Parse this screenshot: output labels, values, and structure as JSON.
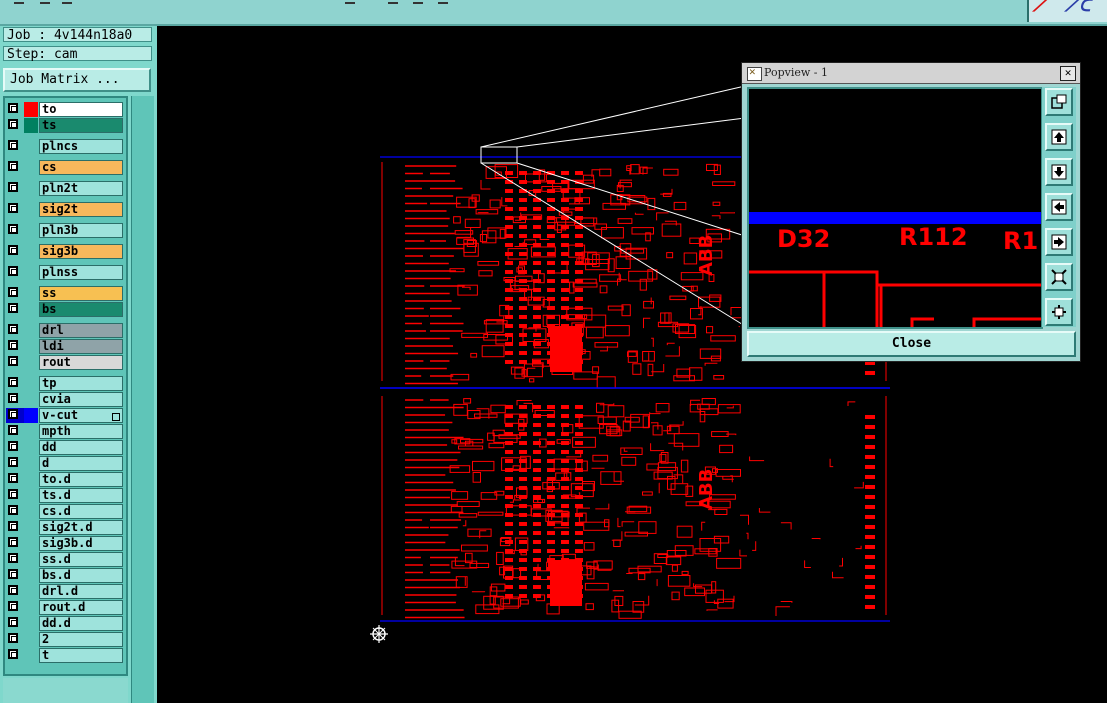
{
  "job_info": {
    "job_line": "Job : 4v144n18a0",
    "step_line": "Step: cam"
  },
  "job_matrix_button": "Job Matrix ...",
  "layers": [
    {
      "name": "to",
      "swatch": "#ff0000",
      "name_bg": "#ffffff"
    },
    {
      "name": "ts",
      "swatch": "#008060",
      "name_bg": "#1a8a6e"
    },
    {
      "name": "plncs",
      "swatch": "",
      "name_bg": "#9ee3dc"
    },
    {
      "name": "cs",
      "swatch": "",
      "name_bg": "#f7b85c"
    },
    {
      "name": "pln2t",
      "swatch": "",
      "name_bg": "#9ee3dc"
    },
    {
      "name": "sig2t",
      "swatch": "",
      "name_bg": "#f7b85c"
    },
    {
      "name": "pln3b",
      "swatch": "",
      "name_bg": "#9ee3dc"
    },
    {
      "name": "sig3b",
      "swatch": "",
      "name_bg": "#f7b85c"
    },
    {
      "name": "plnss",
      "swatch": "",
      "name_bg": "#9ee3dc"
    },
    {
      "name": "ss",
      "swatch": "",
      "name_bg": "#f7c052"
    },
    {
      "name": "bs",
      "swatch": "",
      "name_bg": "#1a8a6e"
    },
    {
      "name": "drl",
      "swatch": "",
      "name_bg": "#8fa3a8"
    },
    {
      "name": "ldi",
      "swatch": "",
      "name_bg": "#8fa3a8"
    },
    {
      "name": "rout",
      "swatch": "",
      "name_bg": "#d8d8d8"
    },
    {
      "name": "tp",
      "swatch": "",
      "name_bg": "#9ee3dc"
    },
    {
      "name": "cvia",
      "swatch": "",
      "name_bg": "#9ee3dc"
    },
    {
      "name": "v-cut",
      "swatch": "#0000ff",
      "name_bg": "#9ee3dc"
    },
    {
      "name": "mpth",
      "swatch": "",
      "name_bg": "#9ee3dc"
    },
    {
      "name": "dd",
      "swatch": "",
      "name_bg": "#9ee3dc"
    },
    {
      "name": "d",
      "swatch": "",
      "name_bg": "#9ee3dc"
    },
    {
      "name": "to.d",
      "swatch": "",
      "name_bg": "#9ee3dc"
    },
    {
      "name": "ts.d",
      "swatch": "",
      "name_bg": "#9ee3dc"
    },
    {
      "name": "cs.d",
      "swatch": "",
      "name_bg": "#9ee3dc"
    },
    {
      "name": "sig2t.d",
      "swatch": "",
      "name_bg": "#9ee3dc"
    },
    {
      "name": "sig3b.d",
      "swatch": "",
      "name_bg": "#9ee3dc"
    },
    {
      "name": "ss.d",
      "swatch": "",
      "name_bg": "#9ee3dc"
    },
    {
      "name": "bs.d",
      "swatch": "",
      "name_bg": "#9ee3dc"
    },
    {
      "name": "drl.d",
      "swatch": "",
      "name_bg": "#9ee3dc"
    },
    {
      "name": "rout.d",
      "swatch": "",
      "name_bg": "#9ee3dc"
    },
    {
      "name": "dd.d",
      "swatch": "",
      "name_bg": "#9ee3dc"
    },
    {
      "name": "2",
      "swatch": "",
      "name_bg": "#9ee3dc"
    },
    {
      "name": "t",
      "swatch": "",
      "name_bg": "#9ee3dc"
    }
  ],
  "popview": {
    "title": "Popview - 1",
    "close_label": "Close",
    "zoom_labels": [
      "D32",
      "R112",
      "R1"
    ],
    "tool_buttons": [
      "zoom-fit-icon",
      "pan-up-icon",
      "pan-down-icon",
      "pan-left-icon",
      "pan-right-icon",
      "zoom-in-icon",
      "zoom-out-icon"
    ]
  },
  "board": {
    "silkscreen_text": "ABB"
  },
  "colors": {
    "trace": "#ff0000",
    "vcut": "#0000ff",
    "panel": "#7fd8cc"
  }
}
